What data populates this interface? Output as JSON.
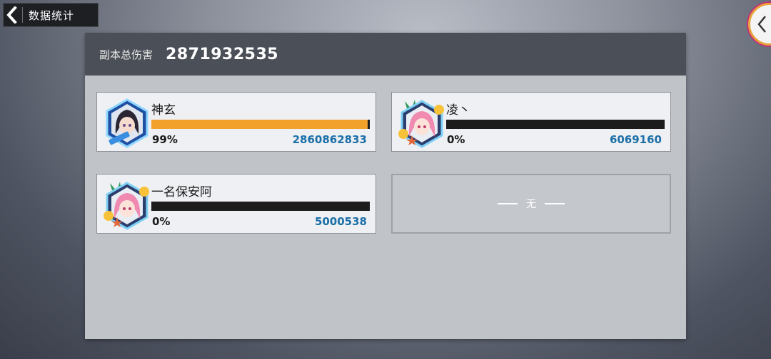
{
  "topbar": {
    "title": "数据统计"
  },
  "panel": {
    "total_label": "副本总伤害",
    "total_value": "2871932535"
  },
  "players": [
    {
      "name": "神玄",
      "percent": "99%",
      "damage": "2860862833",
      "fill_fraction": 0.99,
      "avatar": "dark-hair-character-icon"
    },
    {
      "name": "凌丶",
      "percent": "0%",
      "damage": "6069160",
      "fill_fraction": 0.0,
      "avatar": "pink-hair-character-icon"
    },
    {
      "name": "一名保安阿",
      "percent": "0%",
      "damage": "5000538",
      "fill_fraction": 0.0,
      "avatar": "pink-hair-character-icon"
    }
  ],
  "empty_slot": {
    "label": "无"
  },
  "colors": {
    "bar_fill": "#f2a12b",
    "damage_text": "#1b6fa8",
    "header_bg": "#4b4f57"
  }
}
